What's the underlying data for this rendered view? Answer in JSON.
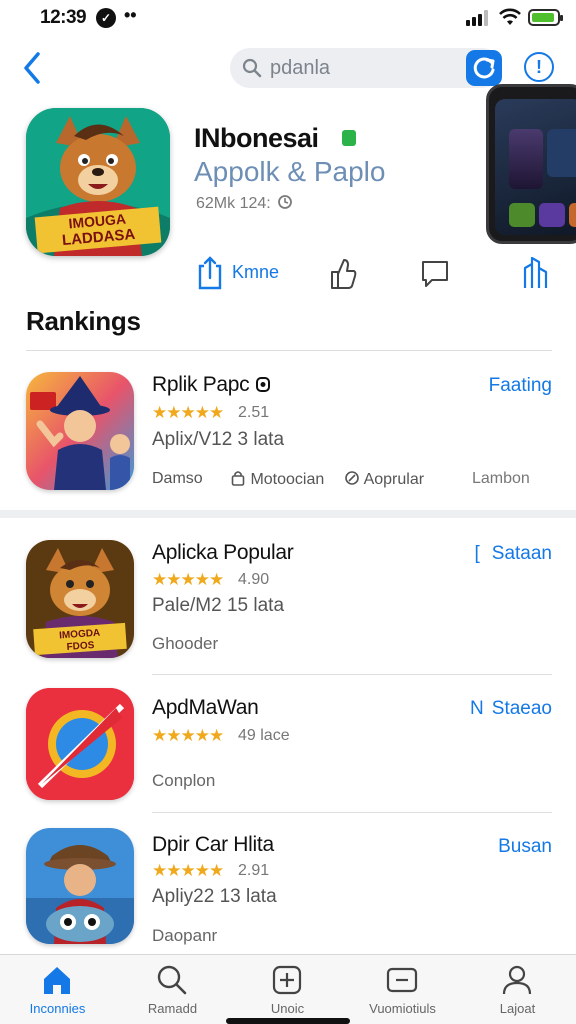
{
  "status": {
    "time": "12:39",
    "dot_glyph": "✓",
    "more": "••"
  },
  "search": {
    "query": "pdanla"
  },
  "hero": {
    "name": "INbonesai",
    "subtitle": "Appolk & Paplo",
    "meta": "62Mk 124:",
    "icon_text": "IMOUGA\nLADDASA",
    "action_label": "Kmne"
  },
  "section": {
    "title": "Rankings"
  },
  "rows": [
    {
      "name": "Rplik Papc",
      "stars": "★★★★★",
      "rating": "2.51",
      "sub": "Aplix/V12 3 lata",
      "action": "Faating",
      "tags": [
        "Damso",
        "Motoocian",
        "Aoprular",
        "Lambon"
      ]
    },
    {
      "name": "Aplicka Popular",
      "stars": "★★★★★",
      "rating": "4.90",
      "sub": "Pale/M2 15 lata",
      "category": "Ghooder",
      "action": "Sataan",
      "action_prefix": "["
    },
    {
      "name": "ApdMaWan",
      "stars": "★★★★★",
      "rating": "49 lace",
      "category": "Conplon",
      "action": "Staeao",
      "action_prefix": "N"
    },
    {
      "name": "Dpir Car Hlita",
      "stars": "★★★★★",
      "rating": "2.91",
      "sub": "Apliy22 13 lata",
      "category": "Daopanr",
      "action": "Busan"
    }
  ],
  "tabs": [
    {
      "label": "Inconnies",
      "icon": "home-icon",
      "active": true
    },
    {
      "label": "Ramadd",
      "icon": "search-icon"
    },
    {
      "label": "Unoic",
      "icon": "plus-box-icon"
    },
    {
      "label": "Vuomiotiuls",
      "icon": "minus-box-icon"
    },
    {
      "label": "Lajoat",
      "icon": "person-icon"
    }
  ],
  "colors": {
    "accent": "#1479e6",
    "star": "#f0a91d",
    "verified": "#2bb34a"
  }
}
